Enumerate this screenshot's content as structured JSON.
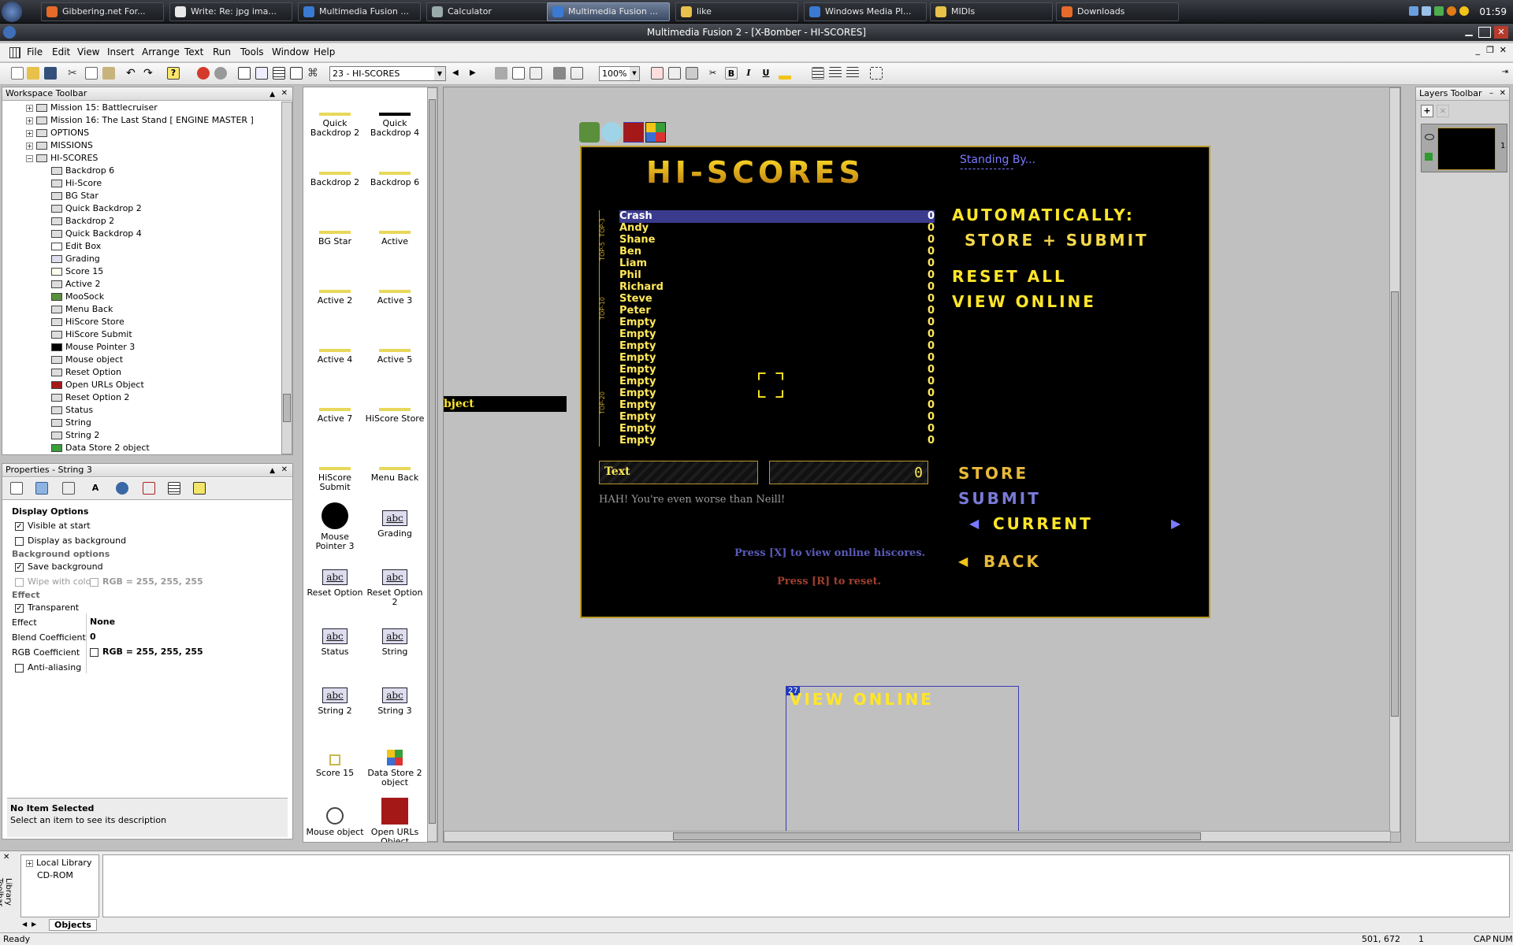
{
  "taskbar": {
    "tabs": [
      "Gibbering.net For...",
      "Write: Re: jpg ima...",
      "Multimedia Fusion ...",
      "Calculator",
      "Multimedia Fusion ...",
      "like",
      "Windows Media Pl...",
      "MIDIs",
      "Downloads"
    ],
    "clock": "01:59"
  },
  "window": {
    "title": "Multimedia Fusion 2 - [X-Bomber - HI-SCORES]"
  },
  "menu": [
    "File",
    "Edit",
    "View",
    "Insert",
    "Arrange",
    "Text",
    "Run",
    "Tools",
    "Window",
    "Help"
  ],
  "toolbar": {
    "frame_select": "23 - HI-SCORES",
    "zoom": "100%"
  },
  "workspace": {
    "title": "Workspace Toolbar",
    "items": [
      "Mission 15: Battlecruiser",
      "Mission 16: The Last Stand [ ENGINE MASTER ]",
      "OPTIONS",
      "MISSIONS",
      "HI-SCORES",
      "Backdrop 6",
      "Hi-Score",
      "BG Star",
      "Quick Backdrop 2",
      "Backdrop 2",
      "Quick Backdrop 4",
      "Edit Box",
      "Grading",
      "Score 15",
      "Active 2",
      "MooSock",
      "Menu Back",
      "HiScore Store",
      "HiScore Submit",
      "Mouse Pointer 3",
      "Mouse object",
      "Reset Option",
      "Open URLs Object",
      "Reset Option 2",
      "Status",
      "String",
      "String 2",
      "Data Store 2 object"
    ]
  },
  "properties": {
    "title": "Properties - String 3",
    "section": "Display Options",
    "visible_at_start": "Visible at start",
    "display_as_background": "Display as background",
    "bg_options": "Background options",
    "save_background": "Save background",
    "wipe": "Wipe with colo",
    "wipe_rgb": "RGB = 255, 255, 255",
    "effect_header": "Effect",
    "transparent": "Transparent",
    "effect_label": "Effect",
    "effect_value": "None",
    "blend_label": "Blend Coefficient",
    "blend_value": "0",
    "rgb_label": "RGB Coefficient",
    "rgb_value": "RGB = 255, 255, 255",
    "antialias": "Anti-aliasing",
    "no_item": "No Item Selected",
    "no_item_desc": "Select an item to see its description"
  },
  "objects": [
    "Quick Backdrop 2",
    "Quick Backdrop 4",
    "Backdrop 2",
    "Backdrop 6",
    "BG Star",
    "Active",
    "Active 2",
    "Active 3",
    "Active 4",
    "Active 5",
    "Active 7",
    "HiScore Store",
    "HiScore Submit",
    "Menu Back",
    "Mouse Pointer 3",
    "Grading",
    "Reset Option",
    "Reset Option 2",
    "Status",
    "String",
    "String 2",
    "String 3",
    "Score 15",
    "Data Store 2 object",
    "Mouse object",
    "Open URLs Object"
  ],
  "game": {
    "title": "HI-SCORES",
    "status": "Standing By...",
    "status_dashes": "-------------",
    "auto": "AUTOMATICALLY:",
    "store_submit": "STORE + SUBMIT",
    "reset_all": "RESET ALL",
    "view_online": "VIEW ONLINE",
    "text_label": "Text",
    "text_value": "0",
    "insult": "HAH! You're even worse than Neill!",
    "store": "STORE",
    "submit": "SUBMIT",
    "current": "CURRENT",
    "back": "BACK",
    "press_x": "Press [X] to view online hiscores.",
    "press_r": "Press [R] to reset.",
    "scores": [
      [
        "Crash",
        "0"
      ],
      [
        "Andy",
        "0"
      ],
      [
        "Shane",
        "0"
      ],
      [
        "Ben",
        "0"
      ],
      [
        "Liam",
        "0"
      ],
      [
        "Phil",
        "0"
      ],
      [
        "Richard",
        "0"
      ],
      [
        "Steve",
        "0"
      ],
      [
        "Peter",
        "0"
      ],
      [
        "Empty",
        "0"
      ],
      [
        "Empty",
        "0"
      ],
      [
        "Empty",
        "0"
      ],
      [
        "Empty",
        "0"
      ],
      [
        "Empty",
        "0"
      ],
      [
        "Empty",
        "0"
      ],
      [
        "Empty",
        "0"
      ],
      [
        "Empty",
        "0"
      ],
      [
        "Empty",
        "0"
      ],
      [
        "Empty",
        "0"
      ],
      [
        "Empty",
        "0"
      ]
    ],
    "tabs": [
      "TOP-3",
      "TOP-5",
      "TOP-10",
      "TOP-20"
    ]
  },
  "offscreen": {
    "object_label": "bject",
    "view_online": "VIEW ONLINE",
    "badge": "27"
  },
  "layers": {
    "title": "Layers Toolbar",
    "layer_num": "1"
  },
  "library": {
    "title": "Library Toolbar",
    "items": [
      "Local Library",
      "CD-ROM"
    ],
    "tab": "Objects"
  },
  "statusbar": {
    "left": "Ready",
    "coords": "501, 672",
    "layer": "1",
    "caps": "CAP",
    "num": "NUM"
  }
}
